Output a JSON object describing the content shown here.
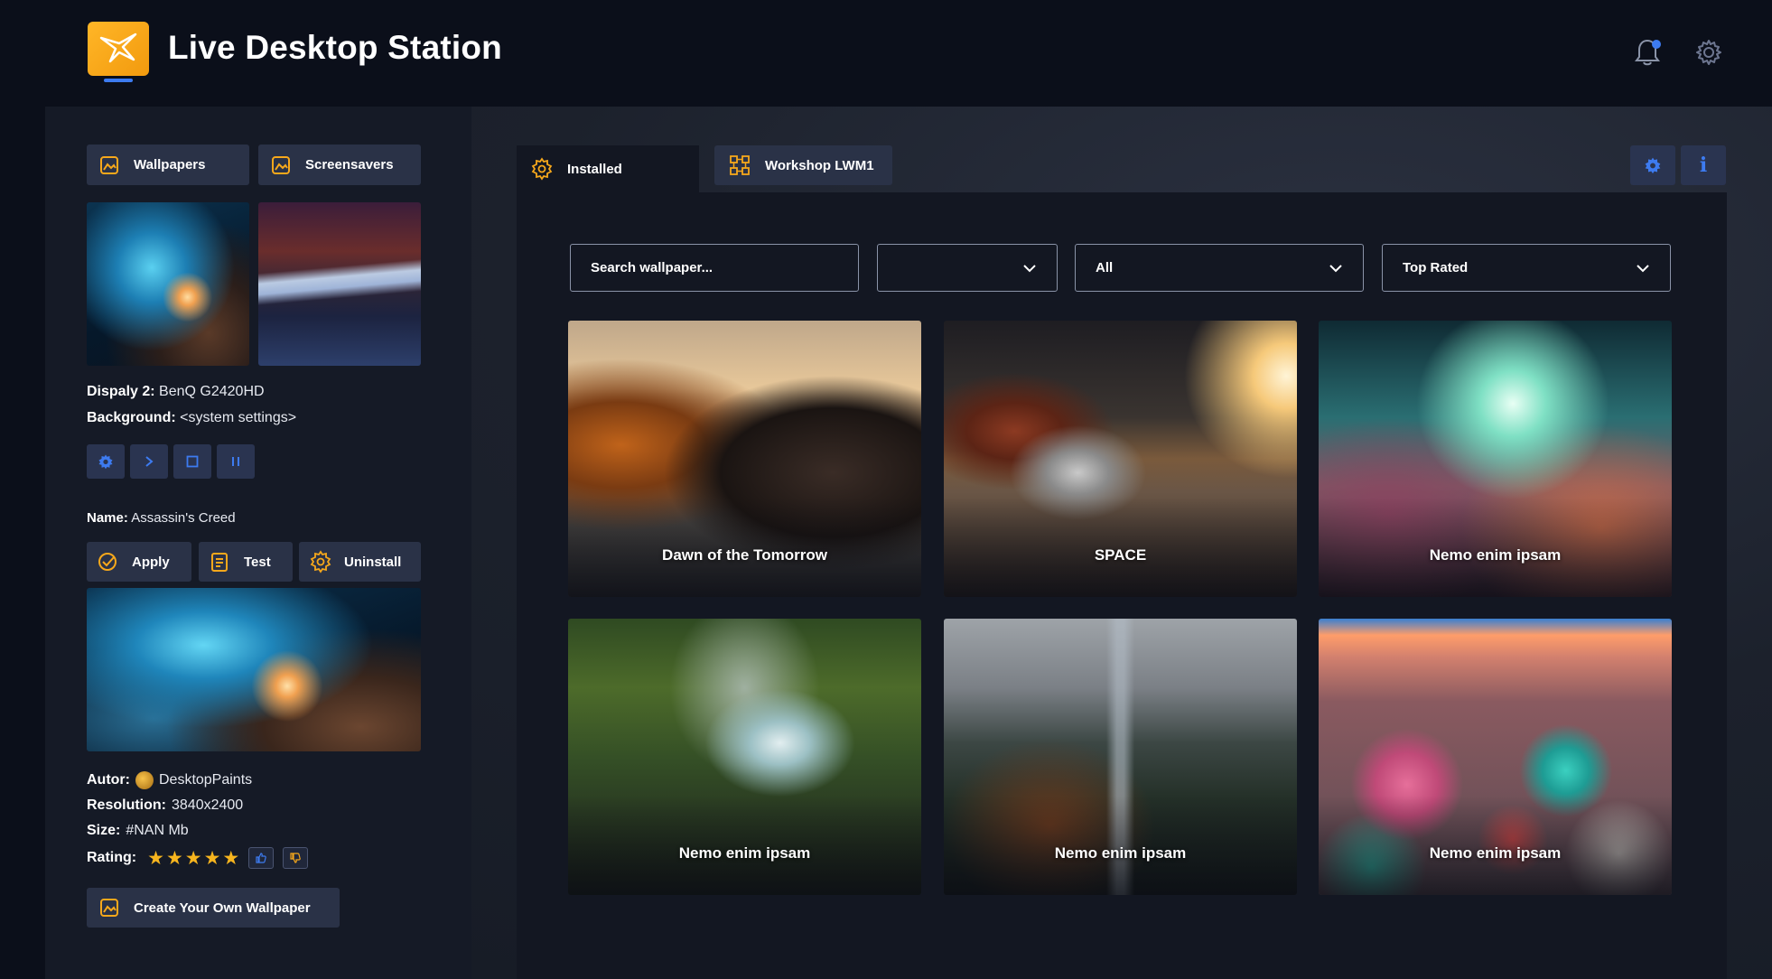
{
  "app": {
    "title": "Live Desktop Station"
  },
  "header": {
    "icons": [
      "bell-icon",
      "gear-icon"
    ],
    "notification_color": "#3d7bf0"
  },
  "sidebar": {
    "tabs": [
      {
        "label": "Wallpapers",
        "icon": "wallpaper-icon"
      },
      {
        "label": "Screensavers",
        "icon": "screensaver-icon"
      }
    ],
    "display": {
      "display_label": "Dispaly 2:",
      "display_value": "BenQ G2420HD",
      "background_label": "Background:",
      "background_value": "<system settings>"
    },
    "controls": [
      "settings-icon",
      "play-icon",
      "stop-icon",
      "pause-icon"
    ],
    "name_label": "Name:",
    "name_value": "Assassin's Creed",
    "actions": [
      {
        "label": "Apply",
        "icon": "apply-icon"
      },
      {
        "label": "Test",
        "icon": "test-icon"
      },
      {
        "label": "Uninstall",
        "icon": "uninstall-icon"
      }
    ],
    "meta": {
      "author_label": "Autor:",
      "author_value": "DesktopPaints",
      "resolution_label": "Resolution:",
      "resolution_value": "3840x2400",
      "size_label": "Size:",
      "size_value": "#NAN Mb",
      "rating_label": "Rating:",
      "rating_value": 5,
      "rating_max": 5
    },
    "create_label": "Create Your Own Wallpaper"
  },
  "content": {
    "tabs": [
      {
        "label": "Installed",
        "icon": "gear-icon",
        "active": true
      },
      {
        "label": "Workshop LWM1",
        "icon": "workshop-icon",
        "active": false
      }
    ],
    "filters": {
      "search_placeholder": "Search wallpaper...",
      "category_value": "",
      "type_value": "All",
      "sort_value": "Top Rated"
    },
    "cards": [
      {
        "title": "Dawn of the Tomorrow"
      },
      {
        "title": "SPACE"
      },
      {
        "title": "Nemo enim ipsam"
      },
      {
        "title": "Nemo enim ipsam"
      },
      {
        "title": "Nemo enim ipsam"
      },
      {
        "title": "Nemo enim ipsam"
      }
    ]
  },
  "colors": {
    "accent": "#3d7bf0",
    "brand": "#f7a81b",
    "button_bg": "#2a3247",
    "star": "#f7b51e"
  }
}
